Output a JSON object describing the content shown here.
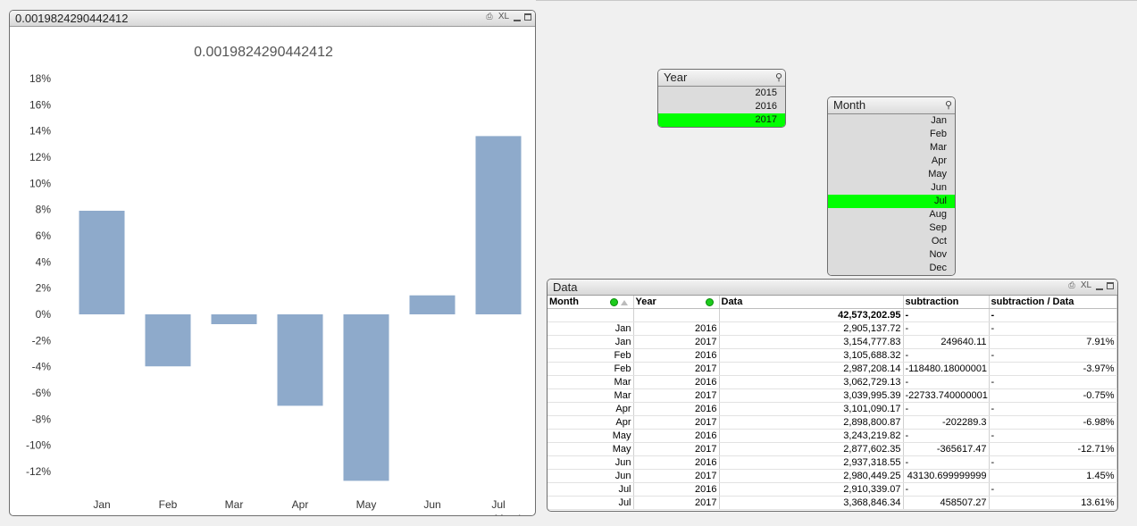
{
  "chart_window": {
    "caption": "0.0019824290442412",
    "icons": [
      "print-icon",
      "xl-icon",
      "minimize-icon",
      "maximize-icon"
    ],
    "xl_label": "XL"
  },
  "chart_data": {
    "type": "bar",
    "title": "0.0019824290442412",
    "xlabel": "Month",
    "ylabel": "",
    "categories": [
      "Jan",
      "Feb",
      "Mar",
      "Apr",
      "May",
      "Jun",
      "Jul"
    ],
    "values": [
      7.91,
      -3.97,
      -0.75,
      -6.98,
      -12.71,
      1.45,
      13.61
    ],
    "y_ticks": [
      "18%",
      "16%",
      "14%",
      "12%",
      "10%",
      "8%",
      "6%",
      "4%",
      "2%",
      "0%",
      "-2%",
      "-4%",
      "-6%",
      "-8%",
      "-10%",
      "-12%"
    ],
    "ylim": [
      -12.5,
      18
    ],
    "bar_color": "#8eaacb",
    "grid": false,
    "legend": "none"
  },
  "year_box": {
    "title": "Year",
    "icon": "search-icon",
    "items": [
      "2015",
      "2016",
      "2017"
    ],
    "selected": "2017"
  },
  "month_box": {
    "title": "Month",
    "icon": "search-icon",
    "items": [
      "Jan",
      "Feb",
      "Mar",
      "Apr",
      "May",
      "Jun",
      "Jul",
      "Aug",
      "Sep",
      "Oct",
      "Nov",
      "Dec"
    ],
    "selected": "Jul"
  },
  "data_table": {
    "caption": "Data",
    "xl_label": "XL",
    "headers": [
      "Month",
      "Year",
      "Data",
      "subtraction",
      "subtraction / Data"
    ],
    "total_row": [
      "",
      "",
      "42,573,202.95",
      "-",
      "-"
    ],
    "rows": [
      [
        "Jan",
        "2016",
        "2,905,137.72",
        "-",
        "-"
      ],
      [
        "Jan",
        "2017",
        "3,154,777.83",
        "249640.11",
        "7.91%"
      ],
      [
        "Feb",
        "2016",
        "3,105,688.32",
        "-",
        "-"
      ],
      [
        "Feb",
        "2017",
        "2,987,208.14",
        "-118480.18000001",
        "-3.97%"
      ],
      [
        "Mar",
        "2016",
        "3,062,729.13",
        "-",
        "-"
      ],
      [
        "Mar",
        "2017",
        "3,039,995.39",
        "-22733.740000001",
        "-0.75%"
      ],
      [
        "Apr",
        "2016",
        "3,101,090.17",
        "-",
        "-"
      ],
      [
        "Apr",
        "2017",
        "2,898,800.87",
        "-202289.3",
        "-6.98%"
      ],
      [
        "May",
        "2016",
        "3,243,219.82",
        "-",
        "-"
      ],
      [
        "May",
        "2017",
        "2,877,602.35",
        "-365617.47",
        "-12.71%"
      ],
      [
        "Jun",
        "2016",
        "2,937,318.55",
        "-",
        "-"
      ],
      [
        "Jun",
        "2017",
        "2,980,449.25",
        "43130.699999999",
        "1.45%"
      ],
      [
        "Jul",
        "2016",
        "2,910,339.07",
        "-",
        "-"
      ],
      [
        "Jul",
        "2017",
        "3,368,846.34",
        "458507.27",
        "13.61%"
      ]
    ]
  },
  "colors": {
    "selection_green": "#00ff00",
    "listbox_gray": "#dcdcdc"
  }
}
